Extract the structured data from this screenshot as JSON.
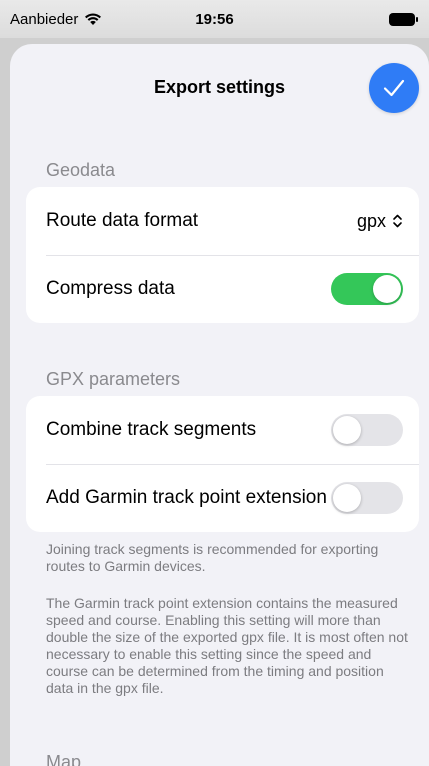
{
  "status_bar": {
    "carrier": "Aanbieder",
    "time": "19:56"
  },
  "sheet": {
    "title": "Export settings"
  },
  "sections": {
    "geodata": {
      "header": "Geodata",
      "route_format": {
        "label": "Route data format",
        "value": "gpx"
      },
      "compress": {
        "label": "Compress data",
        "on": true
      }
    },
    "gpx": {
      "header": "GPX parameters",
      "combine": {
        "label": "Combine track segments",
        "on": false
      },
      "garmin": {
        "label": "Add Garmin track point extension",
        "on": false
      }
    },
    "footnotes": {
      "join": "Joining track segments is recommended for exporting routes to Garmin devices.",
      "garmin": "The Garmin track point extension contains the measured speed and course. Enabling this setting will more than double the size of the exported gpx file. It is most often not necessary to enable this setting since the speed and course can be determined from the timing and position data in the gpx file."
    },
    "map": {
      "header": "Map"
    }
  },
  "colors": {
    "accent": "#2f7cf6",
    "toggle_on": "#34c759"
  }
}
